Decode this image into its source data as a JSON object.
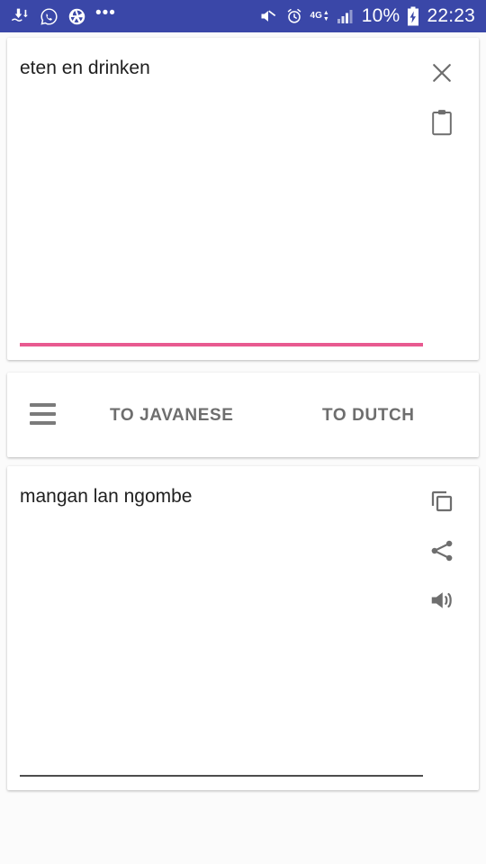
{
  "status_bar": {
    "background_color": "#3a47a8",
    "left_icons": [
      {
        "name": "download-upload-icon",
        "label": "data transfer"
      },
      {
        "name": "whatsapp-icon",
        "label": "WhatsApp"
      },
      {
        "name": "camera-aperture-icon",
        "label": "Camera"
      }
    ],
    "overflow_dots": "•••",
    "right_icons": [
      {
        "name": "mute-icon",
        "label": "Silent"
      },
      {
        "name": "alarm-clock-icon",
        "label": "Alarm"
      },
      {
        "name": "network-4g-icon",
        "label": "4G"
      },
      {
        "name": "signal-bars-icon",
        "label": "Signal"
      }
    ],
    "network_label": "4G",
    "battery_percent": "10%",
    "battery_state": "charging",
    "clock": "22:23"
  },
  "source_card": {
    "text": "eten en drinken",
    "underline_color": "#e85a90",
    "actions": [
      {
        "name": "clear-button",
        "icon": "close-icon",
        "label": "Clear"
      },
      {
        "name": "paste-button",
        "icon": "clipboard-icon",
        "label": "Paste"
      }
    ]
  },
  "language_bar": {
    "menu": {
      "name": "menu-button",
      "icon": "hamburger-icon",
      "label": "Menu"
    },
    "buttons": [
      {
        "name": "translate-to-javanese-button",
        "label": "TO JAVANESE"
      },
      {
        "name": "translate-to-dutch-button",
        "label": "TO DUTCH"
      }
    ]
  },
  "target_card": {
    "text": "mangan lan ngombe",
    "underline_color": "#4d4d4d",
    "actions": [
      {
        "name": "copy-button",
        "icon": "copy-icon",
        "label": "Copy"
      },
      {
        "name": "share-button",
        "icon": "share-icon",
        "label": "Share"
      },
      {
        "name": "speak-button",
        "icon": "speaker-icon",
        "label": "Listen"
      }
    ]
  },
  "colors": {
    "accent_pink": "#e85a90",
    "status_bar": "#3a47a8",
    "page_background": "#fbfbfb",
    "icon_gray": "#6e6e6e"
  }
}
